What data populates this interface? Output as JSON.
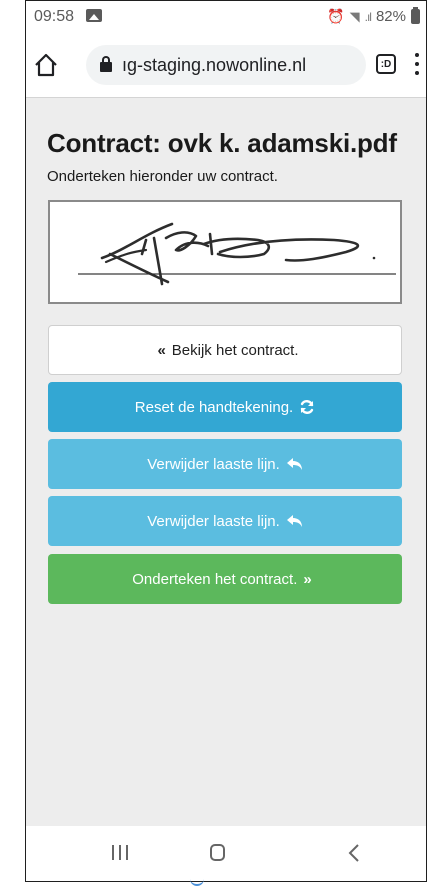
{
  "status_bar": {
    "time": "09:58",
    "battery_percent": "82%"
  },
  "browser": {
    "url": "ıg-staging.nowonline.nl",
    "tabs_label": ":D"
  },
  "page": {
    "title": "Contract: ovk k. adamski.pdf",
    "subtitle": "Onderteken hieronder uw contract."
  },
  "buttons": {
    "view_contract": "Bekijk het contract.",
    "reset_signature": "Reset de handtekening.",
    "undo_last_line_1": "Verwijder laaste lijn.",
    "undo_last_line_2": "Verwijder laaste lijn.",
    "sign_contract": "Onderteken het contract."
  },
  "icons": {
    "view_contract_prefix": "«",
    "sign_contract_suffix": "»"
  },
  "colors": {
    "reset_button": "#33a7d3",
    "undo_button": "#5bbde0",
    "sign_button": "#5cb85c"
  }
}
